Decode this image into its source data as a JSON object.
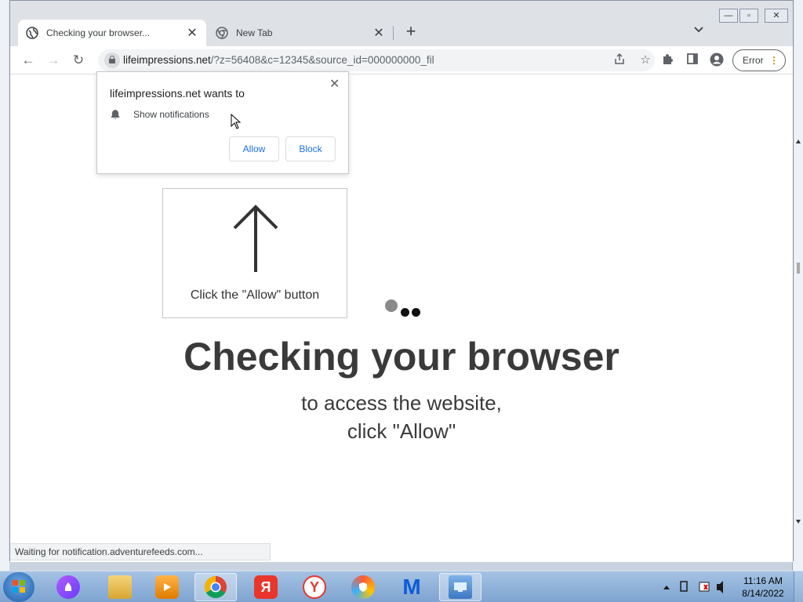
{
  "browser": {
    "tabs": [
      {
        "title": "Checking your browser...",
        "active": true
      },
      {
        "title": "New Tab",
        "active": false
      }
    ],
    "url_domain": "lifeimpressions.net",
    "url_path": "/?z=56408&c=12345&source_id=000000000_fil",
    "profile_button": "Error",
    "status_text": "Waiting for notification.adventurefeeds.com..."
  },
  "permission_popup": {
    "title": "lifeimpressions.net wants to",
    "item": "Show notifications",
    "allow_label": "Allow",
    "block_label": "Block"
  },
  "page": {
    "prompt_text": "Click the \"Allow\" button",
    "headline": "Checking your browser",
    "subline_1": "to access the website,",
    "subline_2": "click \"Allow\""
  },
  "taskbar": {
    "time": "11:16 AM",
    "date": "8/14/2022",
    "apps": [
      "alice-icon",
      "file-explorer-icon",
      "media-player-icon",
      "chrome-icon",
      "yandex-icon",
      "yandex-browser-icon",
      "secure-browser-icon",
      "malwarebytes-icon",
      "control-panel-icon"
    ]
  }
}
